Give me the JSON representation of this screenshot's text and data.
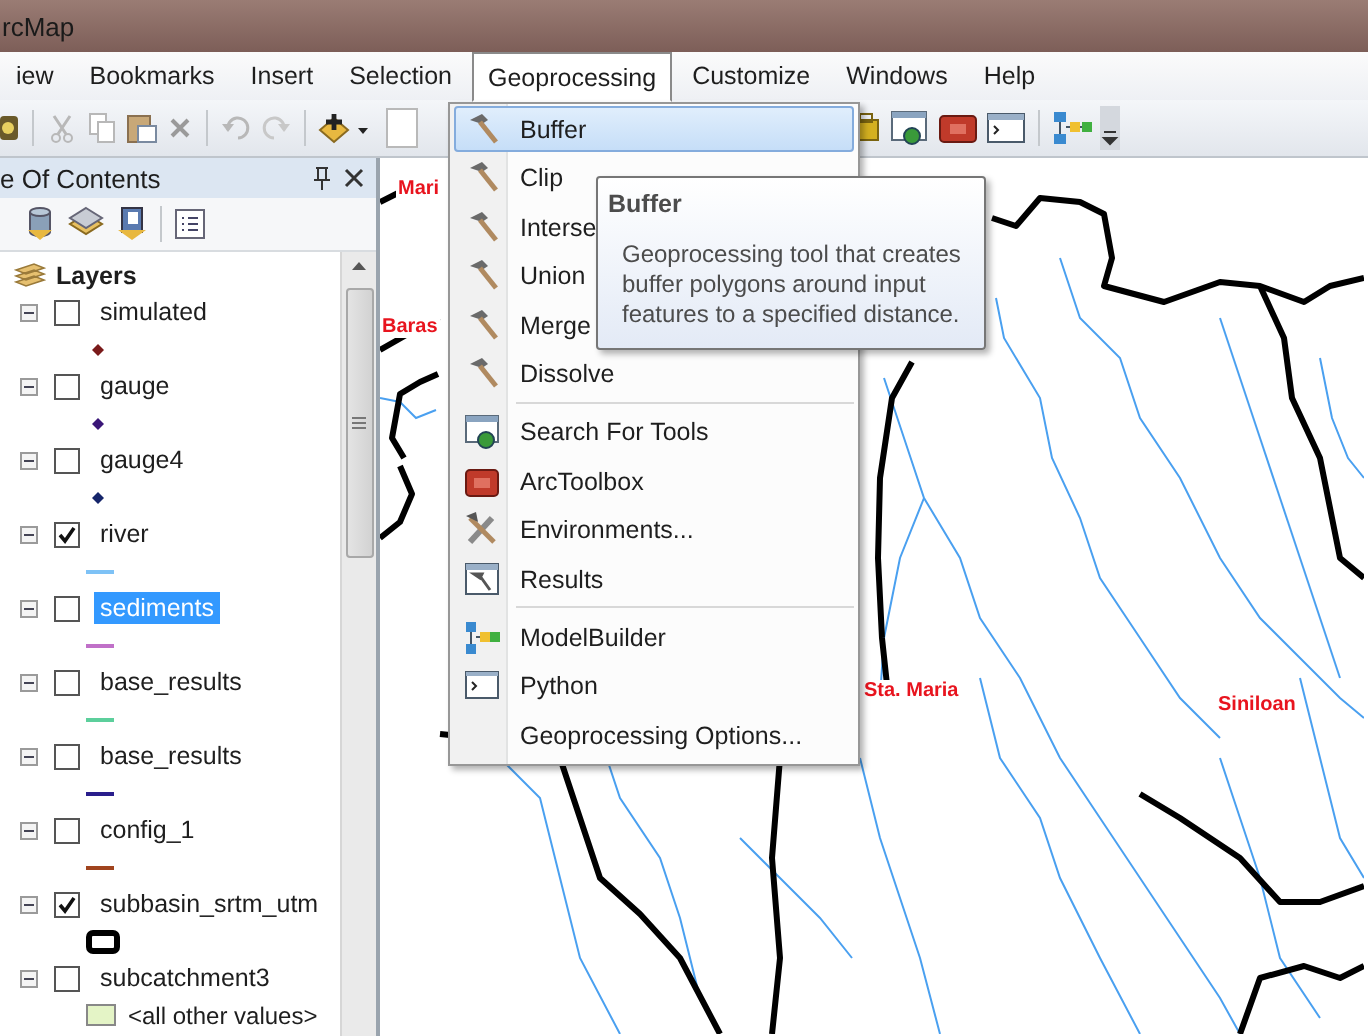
{
  "window": {
    "title": "rcMap"
  },
  "menu_bar": [
    {
      "label": "iew",
      "selected": false
    },
    {
      "label": "Bookmarks",
      "selected": false
    },
    {
      "label": "Insert",
      "selected": false
    },
    {
      "label": "Selection",
      "selected": false
    },
    {
      "label": "Geoprocessing",
      "selected": true
    },
    {
      "label": "Customize",
      "selected": false
    },
    {
      "label": "Windows",
      "selected": false
    },
    {
      "label": "Help",
      "selected": false
    }
  ],
  "toc": {
    "title": "e Of Contents",
    "root": "Layers",
    "layers": [
      {
        "name": "simulated",
        "expanded": true,
        "checked": false,
        "selected": false,
        "symbol": {
          "kind": "point",
          "color": "#7a1a1a"
        }
      },
      {
        "name": "gauge",
        "expanded": true,
        "checked": false,
        "selected": false,
        "symbol": {
          "kind": "point",
          "color": "#3a1678"
        }
      },
      {
        "name": "gauge4",
        "expanded": true,
        "checked": false,
        "selected": false,
        "symbol": {
          "kind": "point",
          "color": "#15256a"
        }
      },
      {
        "name": "river",
        "expanded": true,
        "checked": true,
        "selected": false,
        "symbol": {
          "kind": "line",
          "color": "#7ec2f6"
        }
      },
      {
        "name": "sediments",
        "expanded": true,
        "checked": false,
        "selected": true,
        "symbol": {
          "kind": "line",
          "color": "#c070c8"
        }
      },
      {
        "name": "base_results",
        "expanded": true,
        "checked": false,
        "selected": false,
        "symbol": {
          "kind": "line",
          "color": "#5ccf9c"
        }
      },
      {
        "name": "base_results",
        "expanded": true,
        "checked": false,
        "selected": false,
        "symbol": {
          "kind": "line",
          "color": "#2a1e8c"
        }
      },
      {
        "name": "config_1",
        "expanded": true,
        "checked": false,
        "selected": false,
        "symbol": {
          "kind": "line",
          "color": "#a0441e"
        }
      },
      {
        "name": "subbasin_srtm_utm",
        "expanded": true,
        "checked": true,
        "selected": false,
        "symbol": {
          "kind": "outline",
          "color": "#000000"
        }
      },
      {
        "name": "subcatchment3",
        "expanded": true,
        "checked": false,
        "selected": false,
        "symbol": {
          "kind": "fill",
          "color": "#e4f4c6",
          "label": "<all other values>"
        }
      }
    ]
  },
  "geoprocessing_menu": {
    "groups": [
      {
        "items": [
          {
            "label": "Buffer",
            "selected": true
          },
          {
            "label": "Clip",
            "selected": false
          },
          {
            "label": "Interse",
            "selected": false
          },
          {
            "label": "Union",
            "selected": false
          },
          {
            "label": "Merge",
            "selected": false
          },
          {
            "label": "Dissolve",
            "selected": false
          }
        ]
      },
      {
        "items": [
          {
            "label": "Search For Tools",
            "selected": false
          },
          {
            "label": "ArcToolbox",
            "selected": false
          },
          {
            "label": "Environments...",
            "selected": false
          },
          {
            "label": "Results",
            "selected": false
          }
        ]
      },
      {
        "items": [
          {
            "label": "ModelBuilder",
            "selected": false
          },
          {
            "label": "Python",
            "selected": false
          },
          {
            "label": "Geoprocessing Options...",
            "selected": false
          }
        ]
      }
    ]
  },
  "tooltip": {
    "title": "Buffer",
    "text": "Geoprocessing tool that creates buffer polygons around input features to a specified distance."
  },
  "map": {
    "labels": [
      {
        "text": "Mari"
      },
      {
        "text": "Baras"
      },
      {
        "text": "Sta. Maria"
      },
      {
        "text": "Siniloan"
      }
    ]
  }
}
